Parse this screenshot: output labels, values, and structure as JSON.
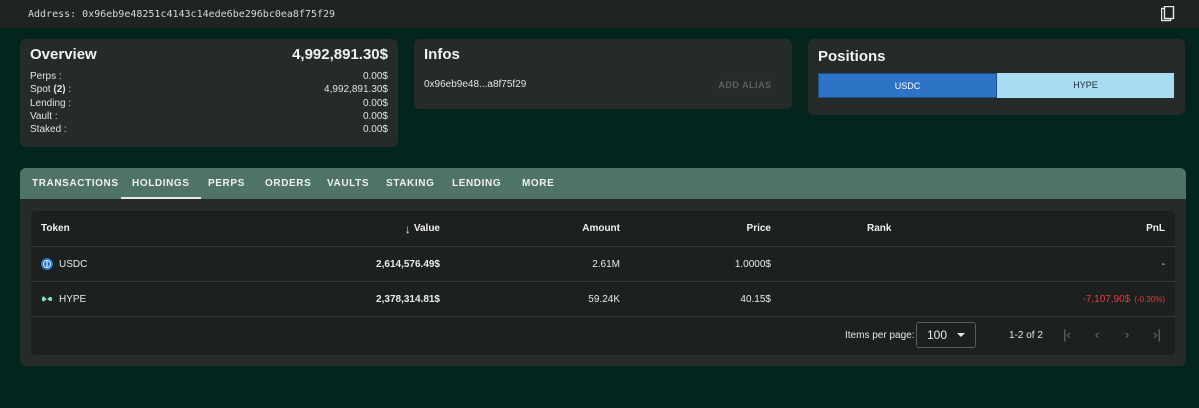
{
  "address_bar": {
    "text": "Address: 0x96eb9e48251c4143c14ede6be296bc0ea8f75f29",
    "copy_icon": "copy-icon"
  },
  "overview": {
    "title": "Overview",
    "total": "4,992,891.30$",
    "rows": [
      {
        "label": "Perps :",
        "value": "0.00$"
      },
      {
        "label_prefix": "Spot ",
        "label_bold": "(2)",
        "label_suffix": " :",
        "value": "4,992,891.30$"
      },
      {
        "label": "Lending :",
        "value": "0.00$"
      },
      {
        "label": "Vault :",
        "value": "0.00$"
      },
      {
        "label": "Staked :",
        "value": "0.00$"
      }
    ]
  },
  "infos": {
    "title": "Infos",
    "address_short": "0x96eb9e48...a8f75f29",
    "alias_button": "ADD ALIAS"
  },
  "positions": {
    "title": "Positions",
    "options": [
      "USDC",
      "HYPE"
    ],
    "selected": "USDC"
  },
  "tabs": [
    "TRANSACTIONS",
    "HOLDINGS",
    "PERPS",
    "ORDERS",
    "VAULTS",
    "STAKING",
    "LENDING",
    "MORE"
  ],
  "active_tab": "HOLDINGS",
  "table": {
    "headers": {
      "token": "Token",
      "value": "Value",
      "amount": "Amount",
      "price": "Price",
      "rank": "Rank",
      "pnl": "PnL"
    },
    "rows": [
      {
        "token": "USDC",
        "icon": "usdc-icon",
        "value": "2,614,576.49$",
        "amount": "2.61M",
        "price": "1.0000$",
        "rank": "",
        "pnl": "-",
        "pnl_pct": ""
      },
      {
        "token": "HYPE",
        "icon": "hype-icon",
        "value": "2,378,314.81$",
        "amount": "59.24K",
        "price": "40.15$",
        "rank": "",
        "pnl": "-7,107.90$",
        "pnl_pct": "(-0.30%)"
      }
    ]
  },
  "pagination": {
    "items_per_page_label": "Items per page:",
    "items_per_page": "100",
    "range": "1-2 of 2"
  },
  "colors": {
    "background": "#04251e",
    "tab_bar": "#4f7467",
    "accent_blue": "#2d74c7",
    "light_blue": "#a8dcf0",
    "negative": "#e23b3b"
  }
}
